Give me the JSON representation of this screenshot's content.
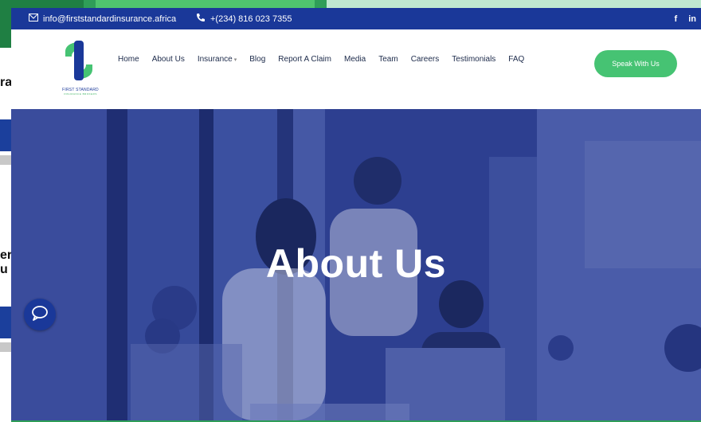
{
  "topbar": {
    "email": "info@firststandardinsurance.africa",
    "phone": "+(234) 816 023 7355",
    "social": [
      "f",
      "in"
    ]
  },
  "logo": {
    "name": "FIRST STANDARD",
    "tagline": "INSURANCE BROKERS"
  },
  "nav": {
    "items": [
      "Home",
      "About Us",
      "Insurance",
      "Blog",
      "Report A Claim",
      "Media",
      "Team",
      "Careers",
      "Testimonials",
      "FAQ"
    ],
    "cta": "Speak With Us"
  },
  "hero": {
    "title": "About Us"
  },
  "background_page": {
    "fragments": [
      "ra",
      "er",
      "u"
    ]
  },
  "colors": {
    "brand_blue": "#1a3899",
    "brand_green": "#46c373",
    "hero_overlay": "#2c3e8f"
  },
  "icons": [
    "mail-icon",
    "phone-icon",
    "facebook-icon",
    "linkedin-icon",
    "chat-icon",
    "chevron-down-icon"
  ]
}
